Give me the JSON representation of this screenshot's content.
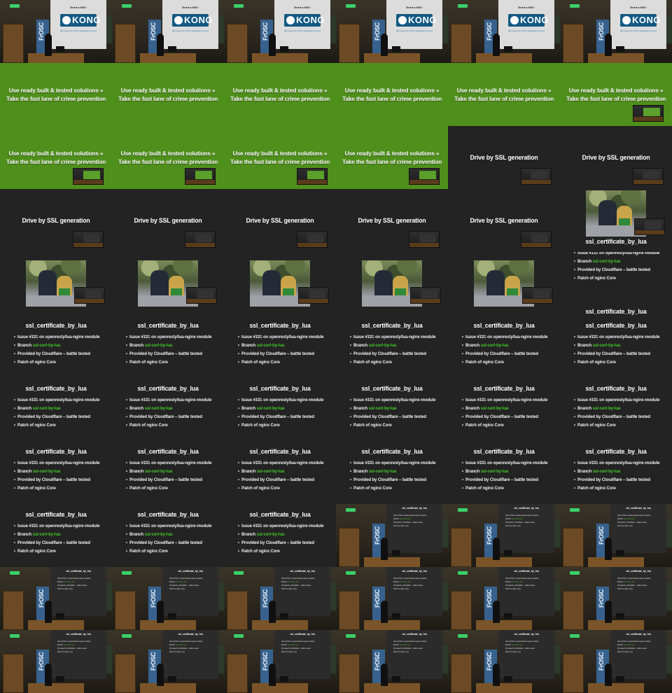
{
  "kong_slide": {
    "heading": "Need a SNI?",
    "logo_text": "KONG",
    "tagline": "Microservice & API management Layer"
  },
  "green_slide": {
    "line1": "Use ready built & tested solutions »",
    "line2": "Take the fast lane of crime prevention"
  },
  "ssl_slide": {
    "title": "Drive by SSL generation"
  },
  "cert_slide": {
    "title": "ssl_certificate_by_lua",
    "items": [
      {
        "prefix": "Issue #331 on openresty/lua-nginx-module",
        "highlight": ""
      },
      {
        "prefix": "Branch ",
        "highlight": "ssl-cert-by-lua"
      },
      {
        "prefix": "Provided by Cloudflare – battle tested",
        "highlight": ""
      },
      {
        "prefix": "Patch of nginx Core",
        "highlight": ""
      }
    ]
  },
  "room": {
    "banner_text": "FrOSC"
  },
  "colors": {
    "green_slide_bg": "#4f8f1c",
    "dark_slide_bg": "#232323",
    "highlight_green": "#46c72b",
    "kong_blue": "#125a84"
  },
  "tile_sequence": [
    "kong",
    "kong",
    "kong",
    "kong",
    "kong",
    "kong",
    "green",
    "green",
    "green",
    "green",
    "green",
    "green-inset",
    "green-inset",
    "green-inset",
    "green-inset",
    "green-inset",
    "ssl",
    "ssl",
    "ssl",
    "ssl",
    "ssl",
    "ssl",
    "ssl",
    "photo-shifted",
    "photo",
    "photo",
    "photo",
    "photo",
    "photo",
    "cert2",
    "cert",
    "cert",
    "cert",
    "cert",
    "cert",
    "cert",
    "cert",
    "cert",
    "cert",
    "cert",
    "cert",
    "cert",
    "cert",
    "cert",
    "cert",
    "cert",
    "cert",
    "cert",
    "cert",
    "cert",
    "cert",
    "room-cert",
    "room-cert",
    "room-cert",
    "room-cert",
    "room-cert",
    "room-cert",
    "room-cert",
    "room-cert",
    "room-cert",
    "room-cert",
    "room-cert",
    "room-cert",
    "room-cert",
    "room-cert",
    "room-cert"
  ]
}
